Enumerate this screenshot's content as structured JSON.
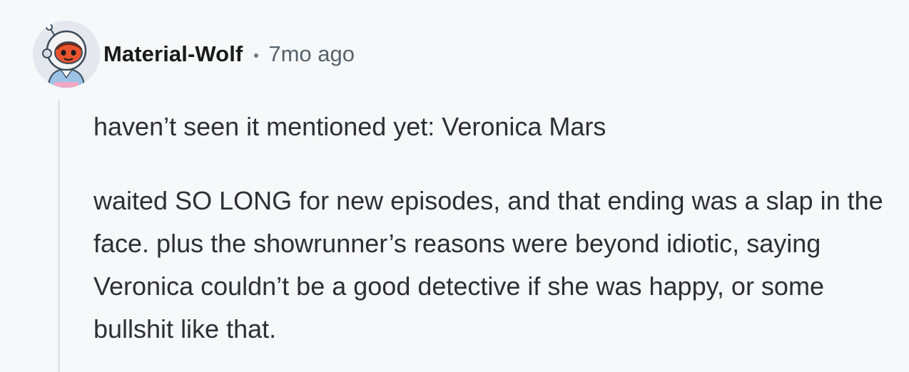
{
  "comment": {
    "author": "Material-Wolf",
    "separator_icon": "dot-separator",
    "timestamp": "7mo ago",
    "avatar_icon": "astronaut-snoo-avatar",
    "paragraphs": [
      "haven’t seen it mentioned yet: Veronica Mars",
      "waited SO LONG for new episodes, and that ending was a slap in the face. plus the showrunner’s reasons were beyond idiotic, saying Veronica couldn’t be a good detective if she was happy, or some bullshit like that."
    ]
  },
  "colors": {
    "background": "#f7f8fa",
    "text": "#2a3035",
    "muted": "#56626d",
    "thread_line": "#dde2e8"
  }
}
